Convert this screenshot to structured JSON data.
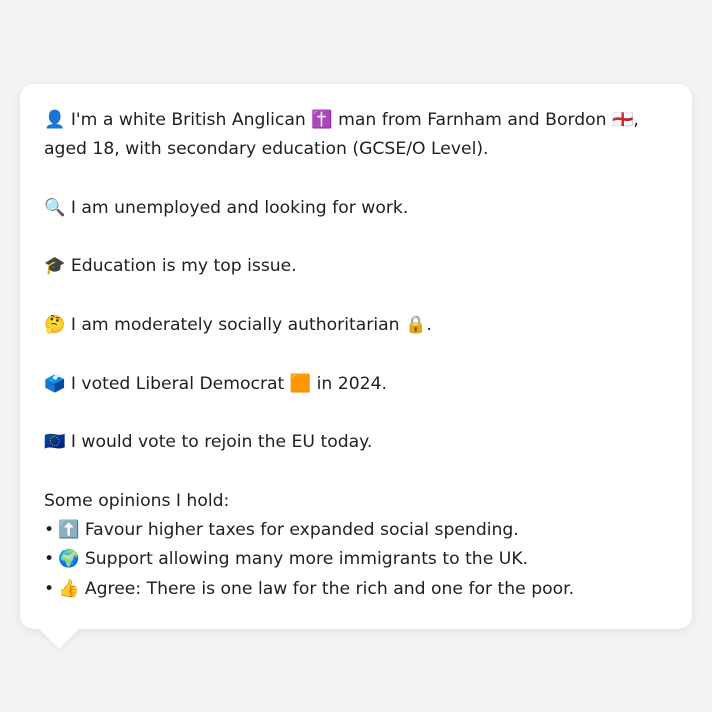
{
  "profile": {
    "identity": "👤 I'm a white British Anglican ✝️ man from Farnham and Bordon 🏴󠁧󠁢󠁥󠁮󠁧󠁿, aged 18, with secondary education (GCSE/O Level).",
    "employment": "🔍 I am unemployed and looking for work.",
    "top_issue": "🎓 Education is my top issue.",
    "social_view": "🤔 I am moderately socially authoritarian 🔒.",
    "vote_2024": "🗳️ I voted Liberal Democrat 🟧 in 2024.",
    "eu_view": "🇪🇺 I would vote to rejoin the EU today."
  },
  "opinions": {
    "heading": "Some opinions I hold:",
    "bullet": "•",
    "items": [
      "⬆️ Favour higher taxes for expanded social spending.",
      "🌍 Support allowing many more immigrants to the UK.",
      "👍 Agree: There is one law for the rich and one for the poor."
    ]
  }
}
